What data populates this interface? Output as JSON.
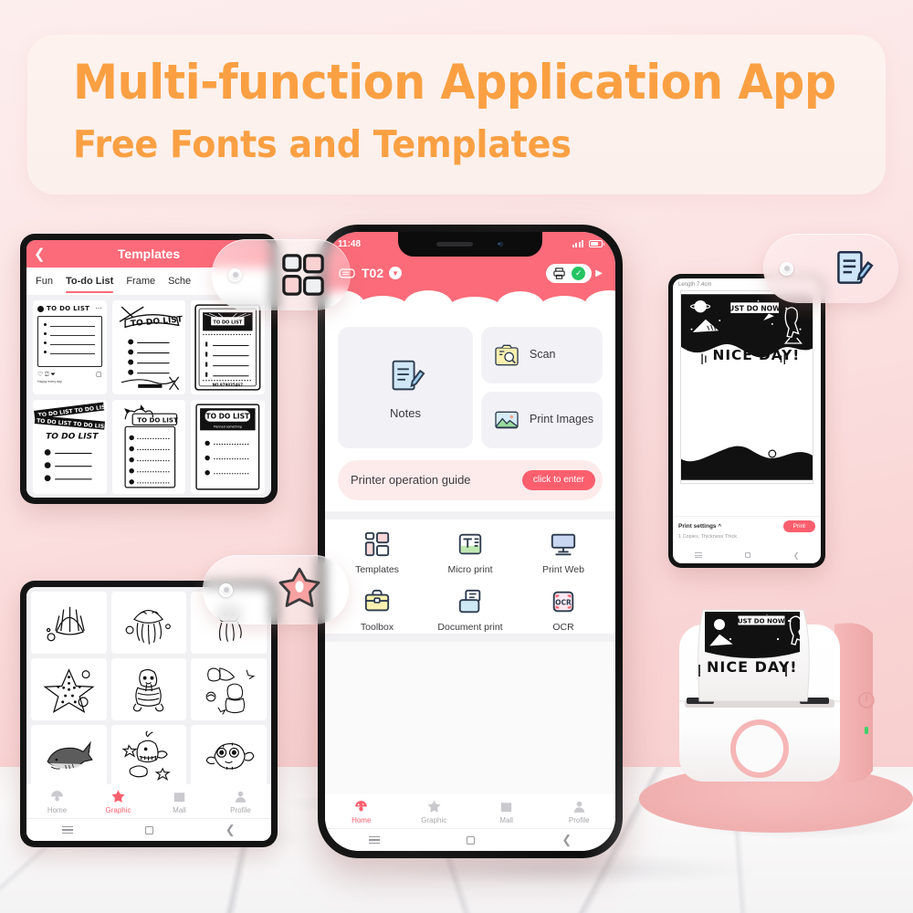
{
  "banner": {
    "headline": "Multi-function Application App",
    "subhead": "Free Fonts and Templates",
    "accent_color": "#faa043",
    "card_color": "#fdf2ee"
  },
  "theme": {
    "brand_pink": "#fb6b79",
    "brand_pink_dark": "#fb5f6e",
    "page_bg_top": "#fdeeee",
    "page_bg_bottom": "#f7cccc",
    "card_gray": "#f2f2f6",
    "green_check": "#25c463"
  },
  "phone_main": {
    "statusbar": {
      "time": "11:48",
      "signal_icon": "signal-bars-icon",
      "battery_icon": "battery-icon"
    },
    "appbar": {
      "device_icon": "printer-device-icon",
      "device_name": "T02",
      "dropdown_icon": "chevron-down-icon",
      "print_icon": "printer-icon",
      "connected_icon": "check-circle-icon",
      "arrow_icon": "arrow-right-icon"
    },
    "cards": [
      {
        "label": "Notes",
        "icon": "notes-icon"
      },
      {
        "label": "Scan",
        "icon": "scan-icon"
      },
      {
        "label": "Print Images",
        "icon": "image-icon"
      }
    ],
    "guide": {
      "text": "Printer operation guide",
      "cta": "click to enter"
    },
    "functions": [
      {
        "label": "Templates",
        "icon": "templates-grid-icon"
      },
      {
        "label": "Micro print",
        "icon": "micro-print-icon"
      },
      {
        "label": "Print Web",
        "icon": "print-web-icon"
      },
      {
        "label": "Toolbox",
        "icon": "toolbox-icon"
      },
      {
        "label": "Document print",
        "icon": "document-print-icon"
      },
      {
        "label": "OCR",
        "icon": "ocr-icon"
      }
    ],
    "bottom_nav": [
      {
        "label": "Home",
        "icon": "mushroom-icon",
        "active": true
      },
      {
        "label": "Graphic",
        "icon": "star-icon",
        "active": false
      },
      {
        "label": "Mall",
        "icon": "shopping-bag-icon",
        "active": false
      },
      {
        "label": "Profile",
        "icon": "person-icon",
        "active": false
      }
    ],
    "system_bar": {
      "menu_icon": "menu-icon",
      "home_icon": "square-home-icon",
      "back_icon": "back-chevron-icon"
    }
  },
  "tablet_templates": {
    "header": {
      "back_icon": "back-chevron-icon",
      "title": "Templates"
    },
    "tabs": [
      {
        "label": "Fun",
        "active": false
      },
      {
        "label": "To-do List",
        "active": true
      },
      {
        "label": "Frame",
        "active": false
      },
      {
        "label": "Sche",
        "active": false
      }
    ],
    "thumbnails": [
      {
        "caption": "TO DO LIST",
        "style": "social-card",
        "footer": "Happy every day"
      },
      {
        "caption": "TO DO LIST",
        "style": "sketch-cross"
      },
      {
        "caption": "TO DO LIST",
        "style": "ticket-frame",
        "footer": "NO.979835467"
      },
      {
        "caption": "TO DO LIST",
        "style": "tape-banner"
      },
      {
        "caption": "TO DO LIST",
        "style": "cat-header"
      },
      {
        "caption": "TO DO LIST",
        "style": "plaque-header"
      }
    ]
  },
  "tablet_graphic": {
    "thumbnails": [
      {
        "name": "shell-sticker"
      },
      {
        "name": "jellyfish-sticker"
      },
      {
        "name": "squid-sticker"
      },
      {
        "name": "starfish-sticker"
      },
      {
        "name": "walrus-sticker"
      },
      {
        "name": "walrus-group-sticker"
      },
      {
        "name": "shark-sticker"
      },
      {
        "name": "whale-sticker"
      },
      {
        "name": "pufferfish-sticker"
      }
    ],
    "bottom_nav": [
      {
        "label": "Home",
        "icon": "mushroom-icon",
        "active": false
      },
      {
        "label": "Graphic",
        "icon": "star-icon",
        "active": true
      },
      {
        "label": "Mall",
        "icon": "shopping-bag-icon",
        "active": false
      },
      {
        "label": "Profile",
        "icon": "person-icon",
        "active": false
      }
    ]
  },
  "phone_preview": {
    "length_label": "Length 7.4cm",
    "art": {
      "banner_text": "JUST DO NOW!",
      "title_text": "NICE DAY!"
    },
    "print_settings": {
      "label": "Print settings",
      "collapse_icon": "chevron-up-icon",
      "detail": "1 Copies, Thickness Thick",
      "print_button": "Print"
    }
  },
  "badges": [
    {
      "name": "templates-badge",
      "icon": "templates-grid-icon"
    },
    {
      "name": "notes-badge",
      "icon": "notes-icon"
    },
    {
      "name": "star-badge",
      "icon": "star-icon"
    }
  ],
  "printer_device": {
    "name": "pink-mini-thermal-printer",
    "paper_text_banner": "JUST DO NOW!",
    "paper_text_title": "NICE DAY!",
    "power_icon": "power-icon",
    "status_led": "green"
  }
}
